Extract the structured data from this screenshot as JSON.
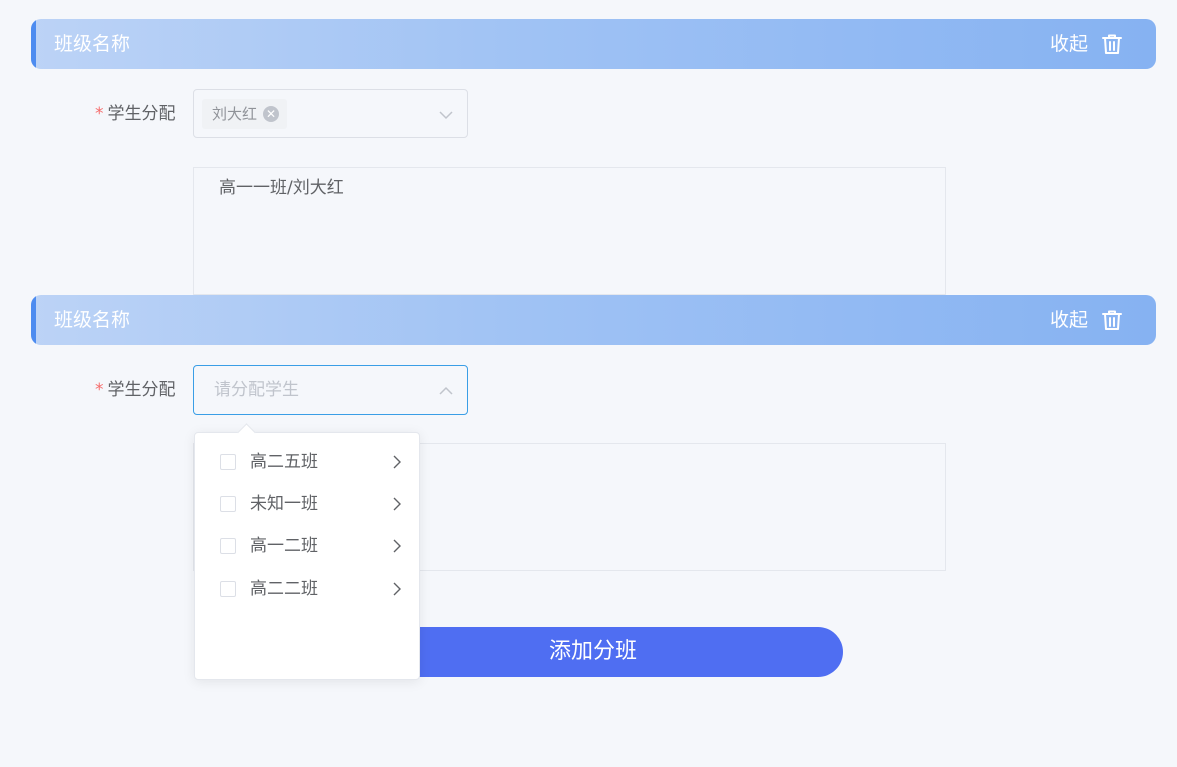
{
  "sections": [
    {
      "title": "班级名称",
      "collapse_label": "收起",
      "field_label": "学生分配",
      "selected_tag": "刘大红",
      "assigned_text": "高一一班/刘大红"
    },
    {
      "title": "班级名称",
      "collapse_label": "收起",
      "field_label": "学生分配",
      "placeholder": "请分配学生"
    }
  ],
  "required_mark": "*",
  "dropdown": {
    "options": [
      {
        "label": "高二五班"
      },
      {
        "label": "未知一班"
      },
      {
        "label": "高一二班"
      },
      {
        "label": "高二二班"
      }
    ]
  },
  "add_button_label": "添加分班",
  "colors": {
    "header_gradient_start": "#bcd3f6",
    "header_gradient_end": "#86b2f2",
    "accent": "#4d8cf0",
    "button": "#4f6ef2",
    "required": "#f56c6c"
  }
}
